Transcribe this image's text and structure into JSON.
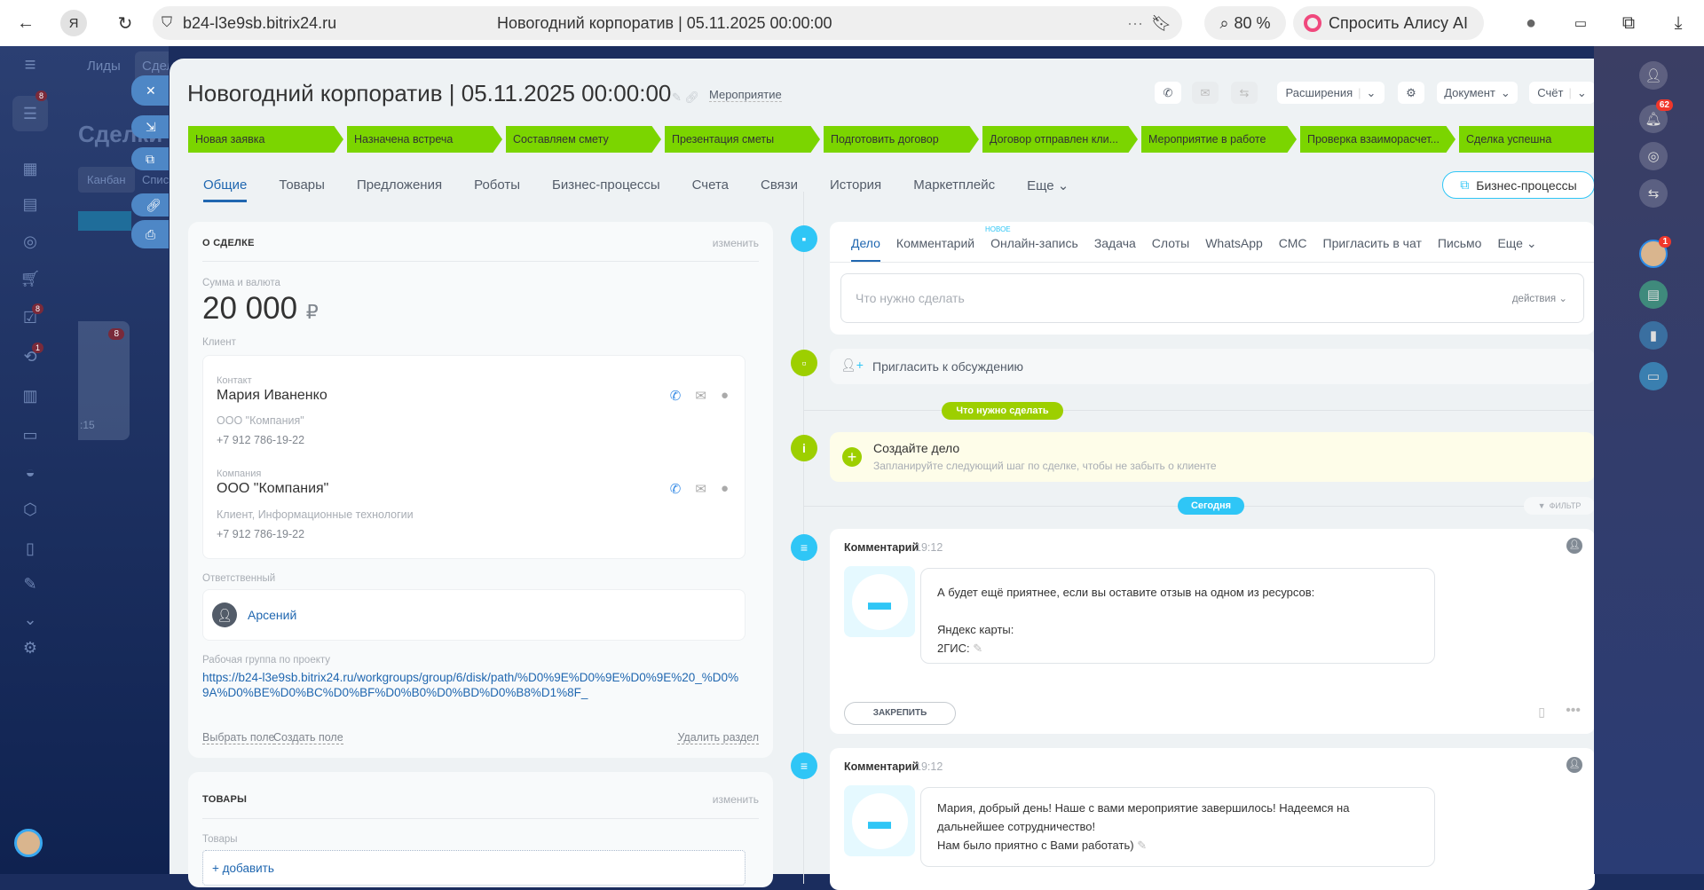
{
  "browser": {
    "url": "b24-l3e9sb.bitrix24.ru",
    "page_title": "Новогодний корпоратив | 05.11.2025 00:00:00",
    "zoom": "80 %",
    "alice": "Спросить Алису AI",
    "yandex": "Я"
  },
  "background": {
    "tabs": [
      "Лиды",
      "Сделки"
    ],
    "page_title": "Сделки",
    "views": [
      "Канбан",
      "Список"
    ],
    "card_badge": "8",
    "time": ":15"
  },
  "leftnav": {
    "badges": {
      "crm": "8",
      "tasks": "8",
      "automation": "1"
    }
  },
  "deal": {
    "title": "Новогодний корпоратив | 05.11.2025 00:00:00",
    "type": "Мероприятие",
    "toolbar": {
      "extensions": "Расширения",
      "document": "Документ",
      "invoice": "Счёт"
    },
    "stages": [
      "Новая заявка",
      "Назначена встреча",
      "Составляем смету",
      "Презентация сметы",
      "Подготовить договор",
      "Договор отправлен кли...",
      "Мероприятие в работе",
      "Проверка взаиморасчет...",
      "Сделка успешна"
    ],
    "tabs": [
      "Общие",
      "Товары",
      "Предложения",
      "Роботы",
      "Бизнес-процессы",
      "Счета",
      "Связи",
      "История",
      "Маркетплейс",
      "Еще"
    ],
    "bp_button": "Бизнес-процессы"
  },
  "about": {
    "header": "О СДЕЛКЕ",
    "edit": "изменить",
    "amount_label": "Сумма и валюта",
    "amount": "20 000",
    "currency": "₽",
    "client_label": "Клиент",
    "contact": {
      "label": "Контакт",
      "name": "Мария Иваненко",
      "company": "ООО \"Компания\"",
      "phone": "+7 912 786-19-22"
    },
    "company": {
      "label": "Компания",
      "name": "ООО \"Компания\"",
      "info": "Клиент, Информационные технологии",
      "phone": "+7 912 786-19-22"
    },
    "responsible_label": "Ответственный",
    "responsible": "Арсений",
    "workgroup_label": "Рабочая группа по проекту",
    "workgroup_link": "https://b24-l3e9sb.bitrix24.ru/workgroups/group/6/disk/path/%D0%9E%D0%9E%D0%9E%20_%D0%9A%D0%BE%D0%BC%D0%BF%D0%B0%D0%BD%D0%B8%D1%8F_",
    "select_field": "Выбрать поле",
    "create_field": "Создать поле",
    "delete_section": "Удалить раздел"
  },
  "products": {
    "header": "ТОВАРЫ",
    "edit": "изменить",
    "label": "Товары",
    "add": "+ добавить"
  },
  "activity": {
    "tabs": [
      "Дело",
      "Комментарий",
      "Онлайн-запись",
      "Задача",
      "Слоты",
      "WhatsApp",
      "СМС",
      "Пригласить в чат",
      "Письмо",
      "Еще"
    ],
    "new_badge": "НОВОЕ",
    "placeholder": "Что нужно сделать",
    "actions": "действия",
    "invite": "Пригласить к обсуждению",
    "todo_pill": "Что нужно сделать",
    "create_title": "Создайте дело",
    "create_sub": "Запланируйте следующий шаг по сделке, чтобы не забыть о клиенте",
    "today_pill": "Сегодня",
    "filter": "ФИЛЬТР"
  },
  "comments": [
    {
      "type": "Комментарий",
      "time": "19:12",
      "lines": [
        "А будет ещё приятнее, если вы оставите отзыв на одном из ресурсов:",
        "",
        "Яндекс карты:",
        "2ГИС:"
      ],
      "pin": "ЗАКРЕПИТЬ"
    },
    {
      "type": "Комментарий",
      "time": "19:12",
      "lines": [
        "Мария, добрый день! Наше с вами мероприятие завершилось! Надеемся на дальнейшее сотрудничество!",
        "Нам было приятно с Вами работать)"
      ]
    }
  ],
  "rightbar": {
    "notifications": "62",
    "chat_badge": "1"
  },
  "colors": {
    "stage": "#7bd500",
    "accent": "#2fc6f6",
    "link": "#2067b0",
    "green": "#9dcf00"
  }
}
